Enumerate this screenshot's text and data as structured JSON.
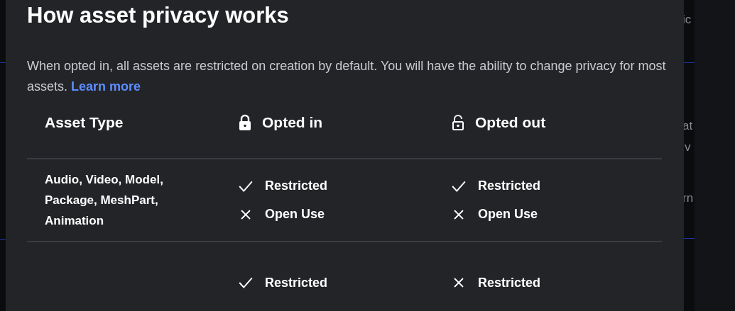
{
  "dialog": {
    "title": "How asset privacy works",
    "description": "When opted in, all assets are restricted on creation by default. You will have the ability to change privacy for most assets.",
    "link": "Learn more"
  },
  "table": {
    "columns": [
      {
        "label": "Asset Type",
        "kind": "text"
      },
      {
        "label": "Opted in",
        "kind": "locked"
      },
      {
        "label": "Opted out",
        "kind": "unlocked"
      }
    ],
    "rows": [
      {
        "asset_type": "Audio, Video, Model, Package, MeshPart, Animation",
        "opted_in": [
          {
            "label": "Restricted",
            "allowed": true
          },
          {
            "label": "Open Use",
            "allowed": false
          }
        ],
        "opted_out": [
          {
            "label": "Restricted",
            "allowed": true
          },
          {
            "label": "Open Use",
            "allowed": false
          }
        ]
      },
      {
        "opted_in": [
          {
            "label": "Restricted",
            "allowed": true
          }
        ],
        "opted_out": [
          {
            "label": "Restricted",
            "allowed": false
          }
        ]
      }
    ]
  },
  "background_fragments": [
    "ic",
    "at",
    "v",
    "rn"
  ]
}
